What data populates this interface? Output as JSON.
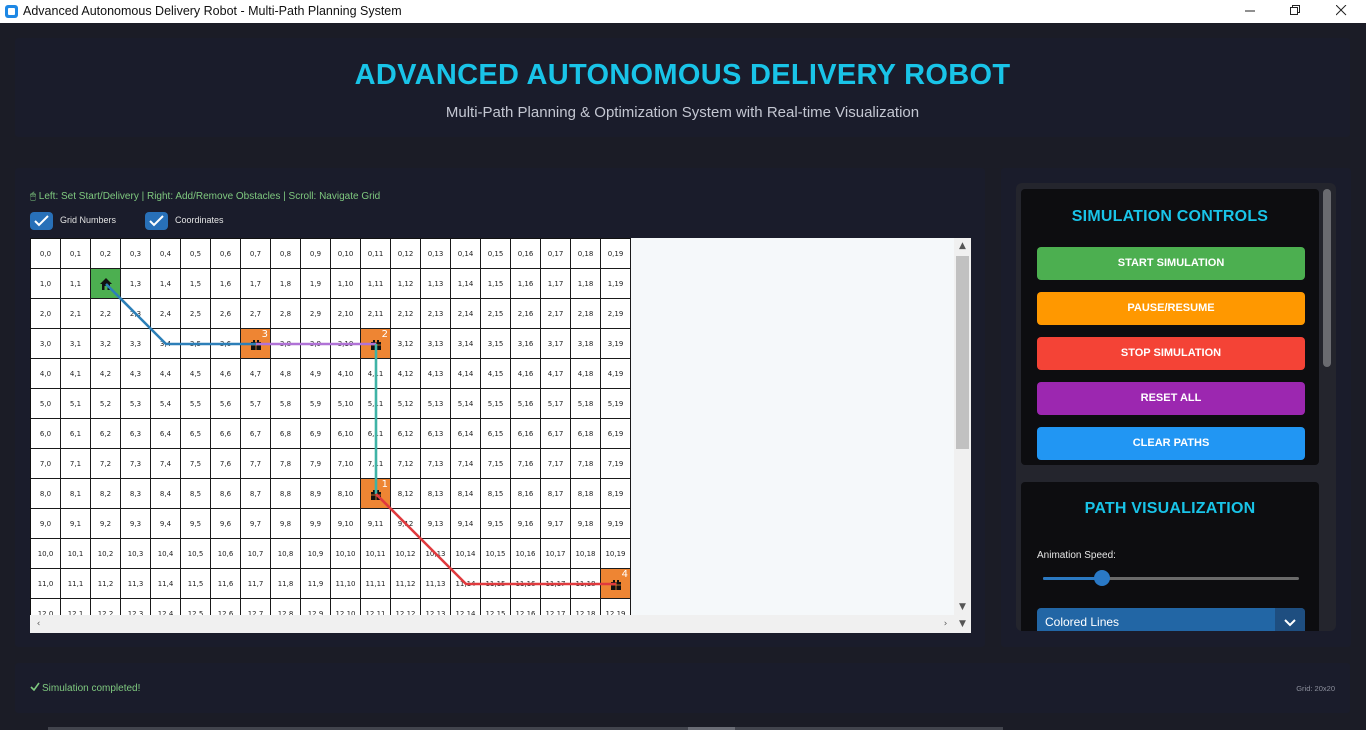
{
  "window": {
    "title": "Advanced Autonomous Delivery Robot - Multi-Path Planning System",
    "minimize_icon": "minimize-icon",
    "maximize_icon": "restore-icon",
    "close_icon": "close-icon"
  },
  "header": {
    "title": "ADVANCED AUTONOMOUS DELIVERY ROBOT",
    "subtitle": "Multi-Path Planning & Optimization System with Real-time Visualization"
  },
  "grid_panel": {
    "instructions": "🖱 Left: Set Start/Delivery | Right: Add/Remove Obstacles | Scroll: Navigate Grid",
    "checkboxes": [
      {
        "label": "Grid Numbers",
        "checked": true
      },
      {
        "label": "Coordinates",
        "checked": true
      }
    ],
    "grid": {
      "rows": 20,
      "cols": 20,
      "visible_rows": 13,
      "start": [
        1,
        2
      ],
      "deliveries": [
        {
          "number": "1",
          "cell": [
            8,
            11
          ]
        },
        {
          "number": "2",
          "cell": [
            3,
            11
          ]
        },
        {
          "number": "3",
          "cell": [
            3,
            7
          ]
        },
        {
          "number": "4",
          "cell": [
            11,
            19
          ]
        }
      ],
      "paths": [
        {
          "color": "#2c7fb8",
          "cells": [
            [
              1,
              2
            ],
            [
              2,
              3
            ],
            [
              3,
              4
            ],
            [
              3,
              5
            ],
            [
              3,
              6
            ],
            [
              3,
              7
            ]
          ]
        },
        {
          "color": "#b072d6",
          "cells": [
            [
              3,
              7
            ],
            [
              3,
              8
            ],
            [
              3,
              9
            ],
            [
              3,
              10
            ],
            [
              3,
              11
            ]
          ]
        },
        {
          "color": "#3fb3a6",
          "cells": [
            [
              3,
              11
            ],
            [
              4,
              11
            ],
            [
              5,
              11
            ],
            [
              6,
              11
            ],
            [
              7,
              11
            ],
            [
              8,
              11
            ]
          ]
        },
        {
          "color": "#e03a3e",
          "cells": [
            [
              8,
              11
            ],
            [
              9,
              12
            ],
            [
              10,
              13
            ],
            [
              11,
              14
            ],
            [
              11,
              15
            ],
            [
              11,
              16
            ],
            [
              11,
              17
            ],
            [
              11,
              18
            ],
            [
              11,
              19
            ]
          ]
        }
      ]
    }
  },
  "controls": {
    "simulation_title": "SIMULATION CONTROLS",
    "buttons": [
      {
        "label": "START SIMULATION",
        "color": "#4caf50"
      },
      {
        "label": "PAUSE/RESUME",
        "color": "#ff9800"
      },
      {
        "label": "STOP SIMULATION",
        "color": "#f44336"
      },
      {
        "label": "RESET ALL",
        "color": "#9c27b0"
      },
      {
        "label": "CLEAR PATHS",
        "color": "#2196f3"
      }
    ],
    "path_title": "PATH VISUALIZATION",
    "animation_speed_label": "Animation Speed:",
    "animation_speed_fraction": 0.23,
    "path_style": "Colored Lines"
  },
  "status": {
    "message": "Simulation completed!",
    "grid_size": "Grid: 20x20",
    "success_color": "#7fc97f"
  }
}
